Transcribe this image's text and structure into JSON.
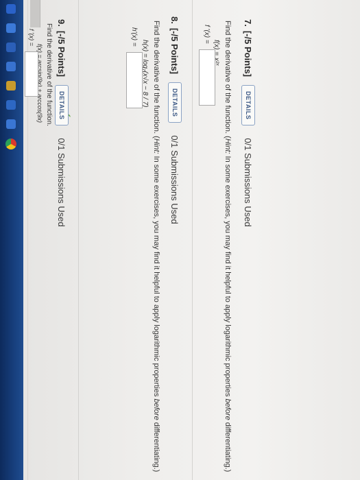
{
  "questions": [
    {
      "number": "7.",
      "points": "[-/5 Points]",
      "details_label": "DETAILS",
      "submissions": "0/1 Submissions Used",
      "instruction_prefix": "Find the derivative of the function. (",
      "hint_label": "Hint:",
      "instruction_rest": " In some exercises, you may find it helpful to apply logarithmic properties ",
      "instruction_em": "before",
      "instruction_end": " differentiating.)",
      "function": "f(x) = x²ˣ",
      "derivative_label": "f '(x) ="
    },
    {
      "number": "8.",
      "points": "[-/5 Points]",
      "details_label": "DETAILS",
      "submissions": "0/1 Submissions Used",
      "instruction_prefix": "Find the derivative of the function. (",
      "hint_label": "Hint:",
      "instruction_rest": " In some exercises, you may find it helpful to apply logarithmic properties ",
      "instruction_em": "before",
      "instruction_end": " differentiating.)",
      "function": "h(x) = log₇(x√x − 8 / 7)",
      "derivative_label": "h'(x) ="
    },
    {
      "number": "9.",
      "points": "[-/5 Points]",
      "details_label": "DETAILS",
      "submissions": "0/1 Submissions Used",
      "instruction_prefix": "Find the derivative of the function.",
      "hint_label": "",
      "instruction_rest": "",
      "instruction_em": "",
      "instruction_end": "",
      "function": "f(x) = arcsin(9x) + arccos(9x)",
      "derivative_label": "f '(x) ="
    }
  ]
}
